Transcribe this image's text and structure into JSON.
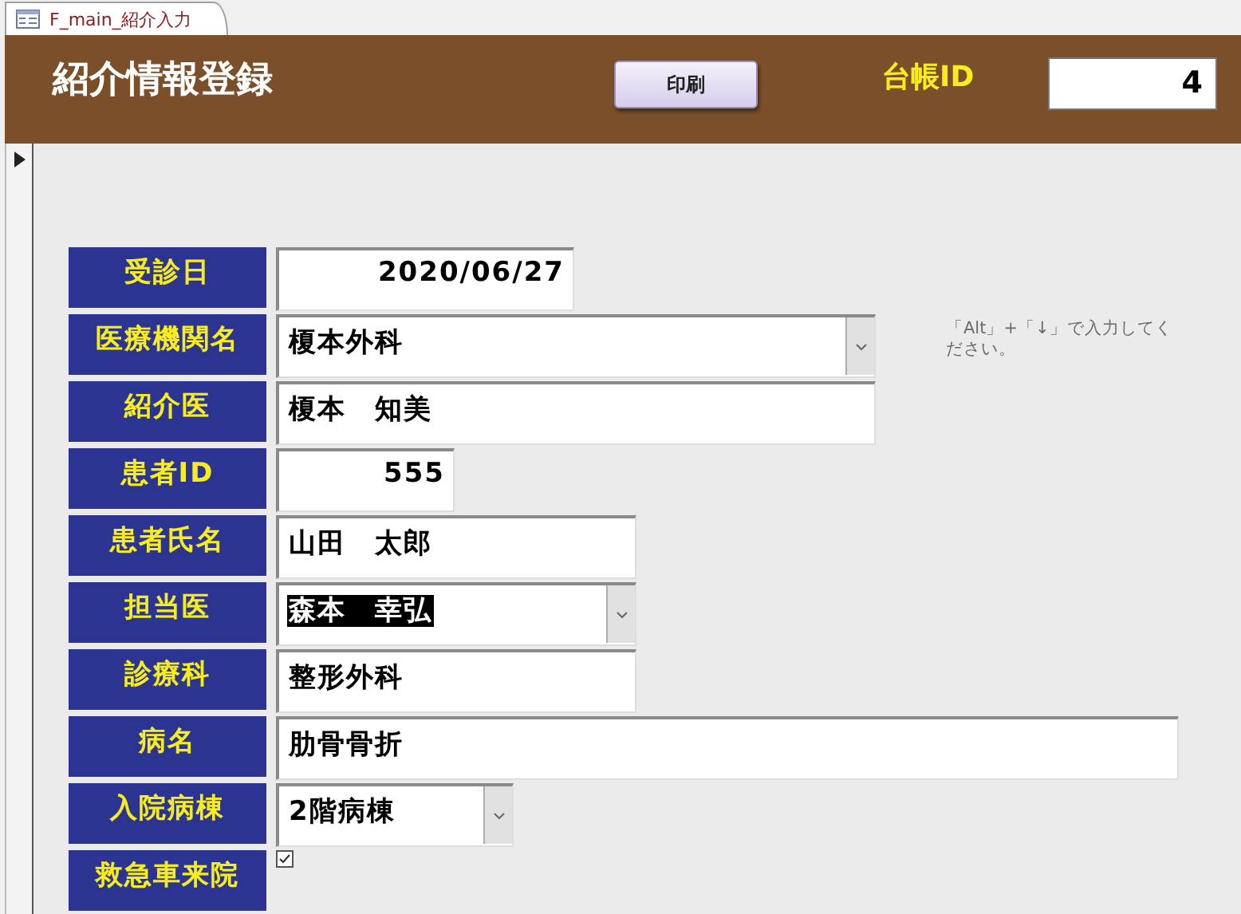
{
  "tab": {
    "label": "F_main_紹介入力"
  },
  "header": {
    "title": "紹介情報登録",
    "print_button": "印刷",
    "id_label": "台帳ID",
    "id_value": "4"
  },
  "fields": [
    {
      "kind": "date",
      "label": "受診日",
      "value": "2020/06/27",
      "highlighted": false
    },
    {
      "kind": "combo",
      "label": "医療機関名",
      "value": "榎本外科",
      "highlighted": false,
      "hint": "「Alt」+「↓」で入力してください。"
    },
    {
      "kind": "text",
      "label": "紹介医",
      "value": "榎本　知美",
      "highlighted": false
    },
    {
      "kind": "number",
      "label": "患者ID",
      "value": "555",
      "highlighted": false
    },
    {
      "kind": "text",
      "label": "患者氏名",
      "value": "山田　太郎",
      "highlighted": false
    },
    {
      "kind": "combo",
      "label": "担当医",
      "value": "森本　幸弘",
      "highlighted": true
    },
    {
      "kind": "text",
      "label": "診療科",
      "value": "整形外科",
      "highlighted": false
    },
    {
      "kind": "text",
      "label": "病名",
      "value": "肋骨骨折",
      "highlighted": false
    },
    {
      "kind": "combo",
      "label": "入院病棟",
      "value": "2階病棟",
      "highlighted": false
    },
    {
      "kind": "checkbox",
      "label": "救急車来院",
      "checked": true
    }
  ]
}
